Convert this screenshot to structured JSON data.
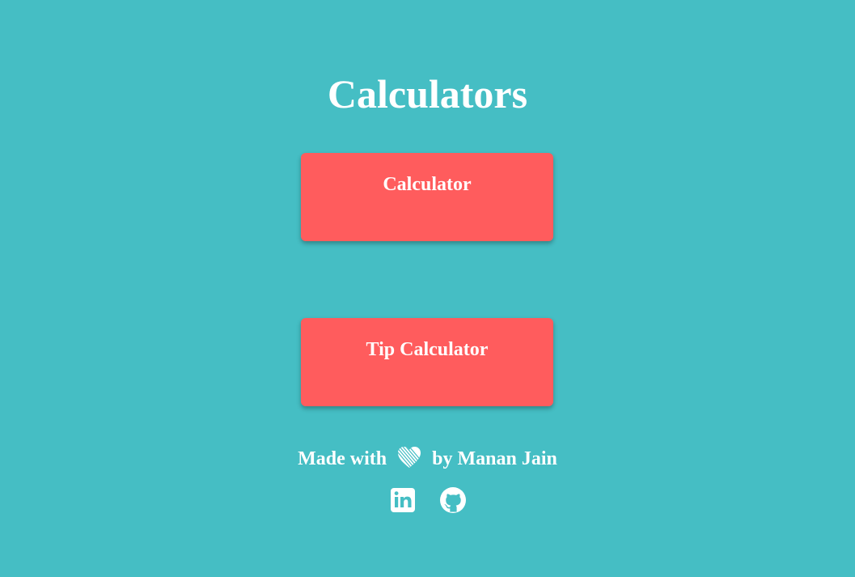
{
  "page": {
    "title": "Calculators",
    "background_color": "#45bec4",
    "accent_color": "#ff5c5d"
  },
  "cards": [
    {
      "label": "Calculator"
    },
    {
      "label": "Tip Calculator"
    }
  ],
  "footer": {
    "prefix": "Made with",
    "heart_icon": "heart-icon",
    "suffix": "by Manan Jain",
    "social_icons": [
      "linkedin-icon",
      "github-icon"
    ]
  }
}
